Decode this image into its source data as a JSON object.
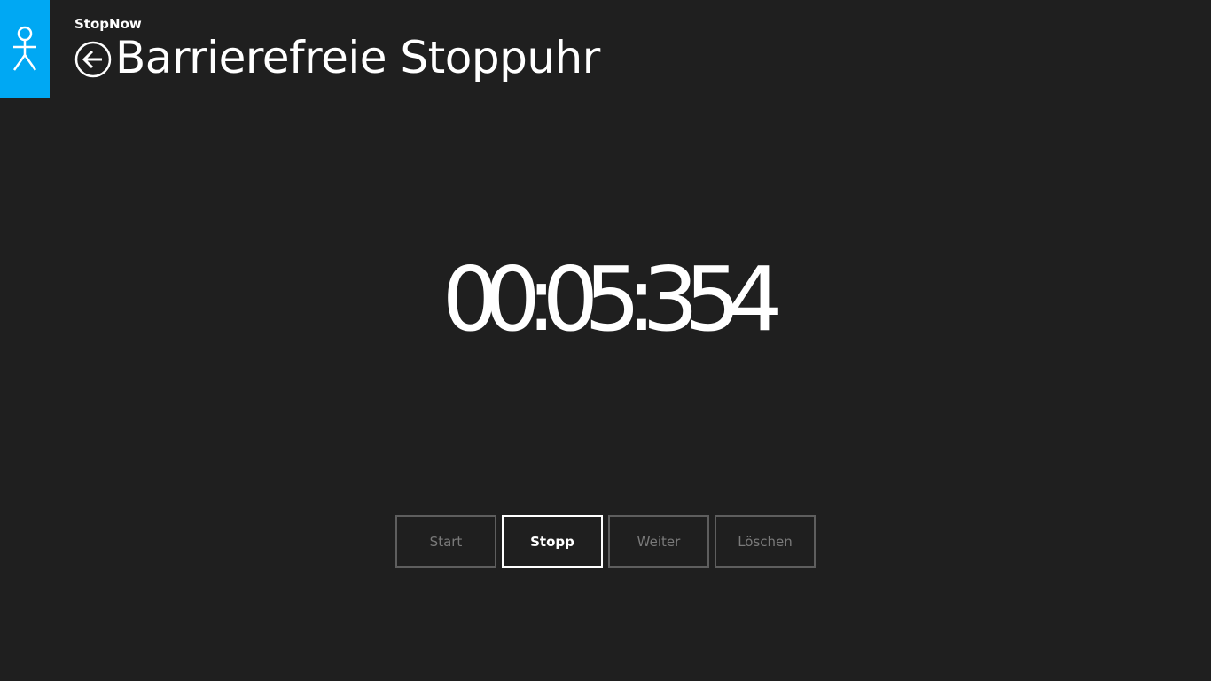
{
  "app": {
    "name": "StopNow",
    "logo_icon": "stick-figure-icon",
    "accent_color": "#00a8f3"
  },
  "header": {
    "back_icon": "back-arrow-icon",
    "title": "Barrierefreie Stoppuhr"
  },
  "timer": {
    "value": "00:05:354"
  },
  "controls": {
    "start_label": "Start",
    "stop_label": "Stopp",
    "resume_label": "Weiter",
    "clear_label": "Löschen",
    "active_button": "Stopp"
  }
}
